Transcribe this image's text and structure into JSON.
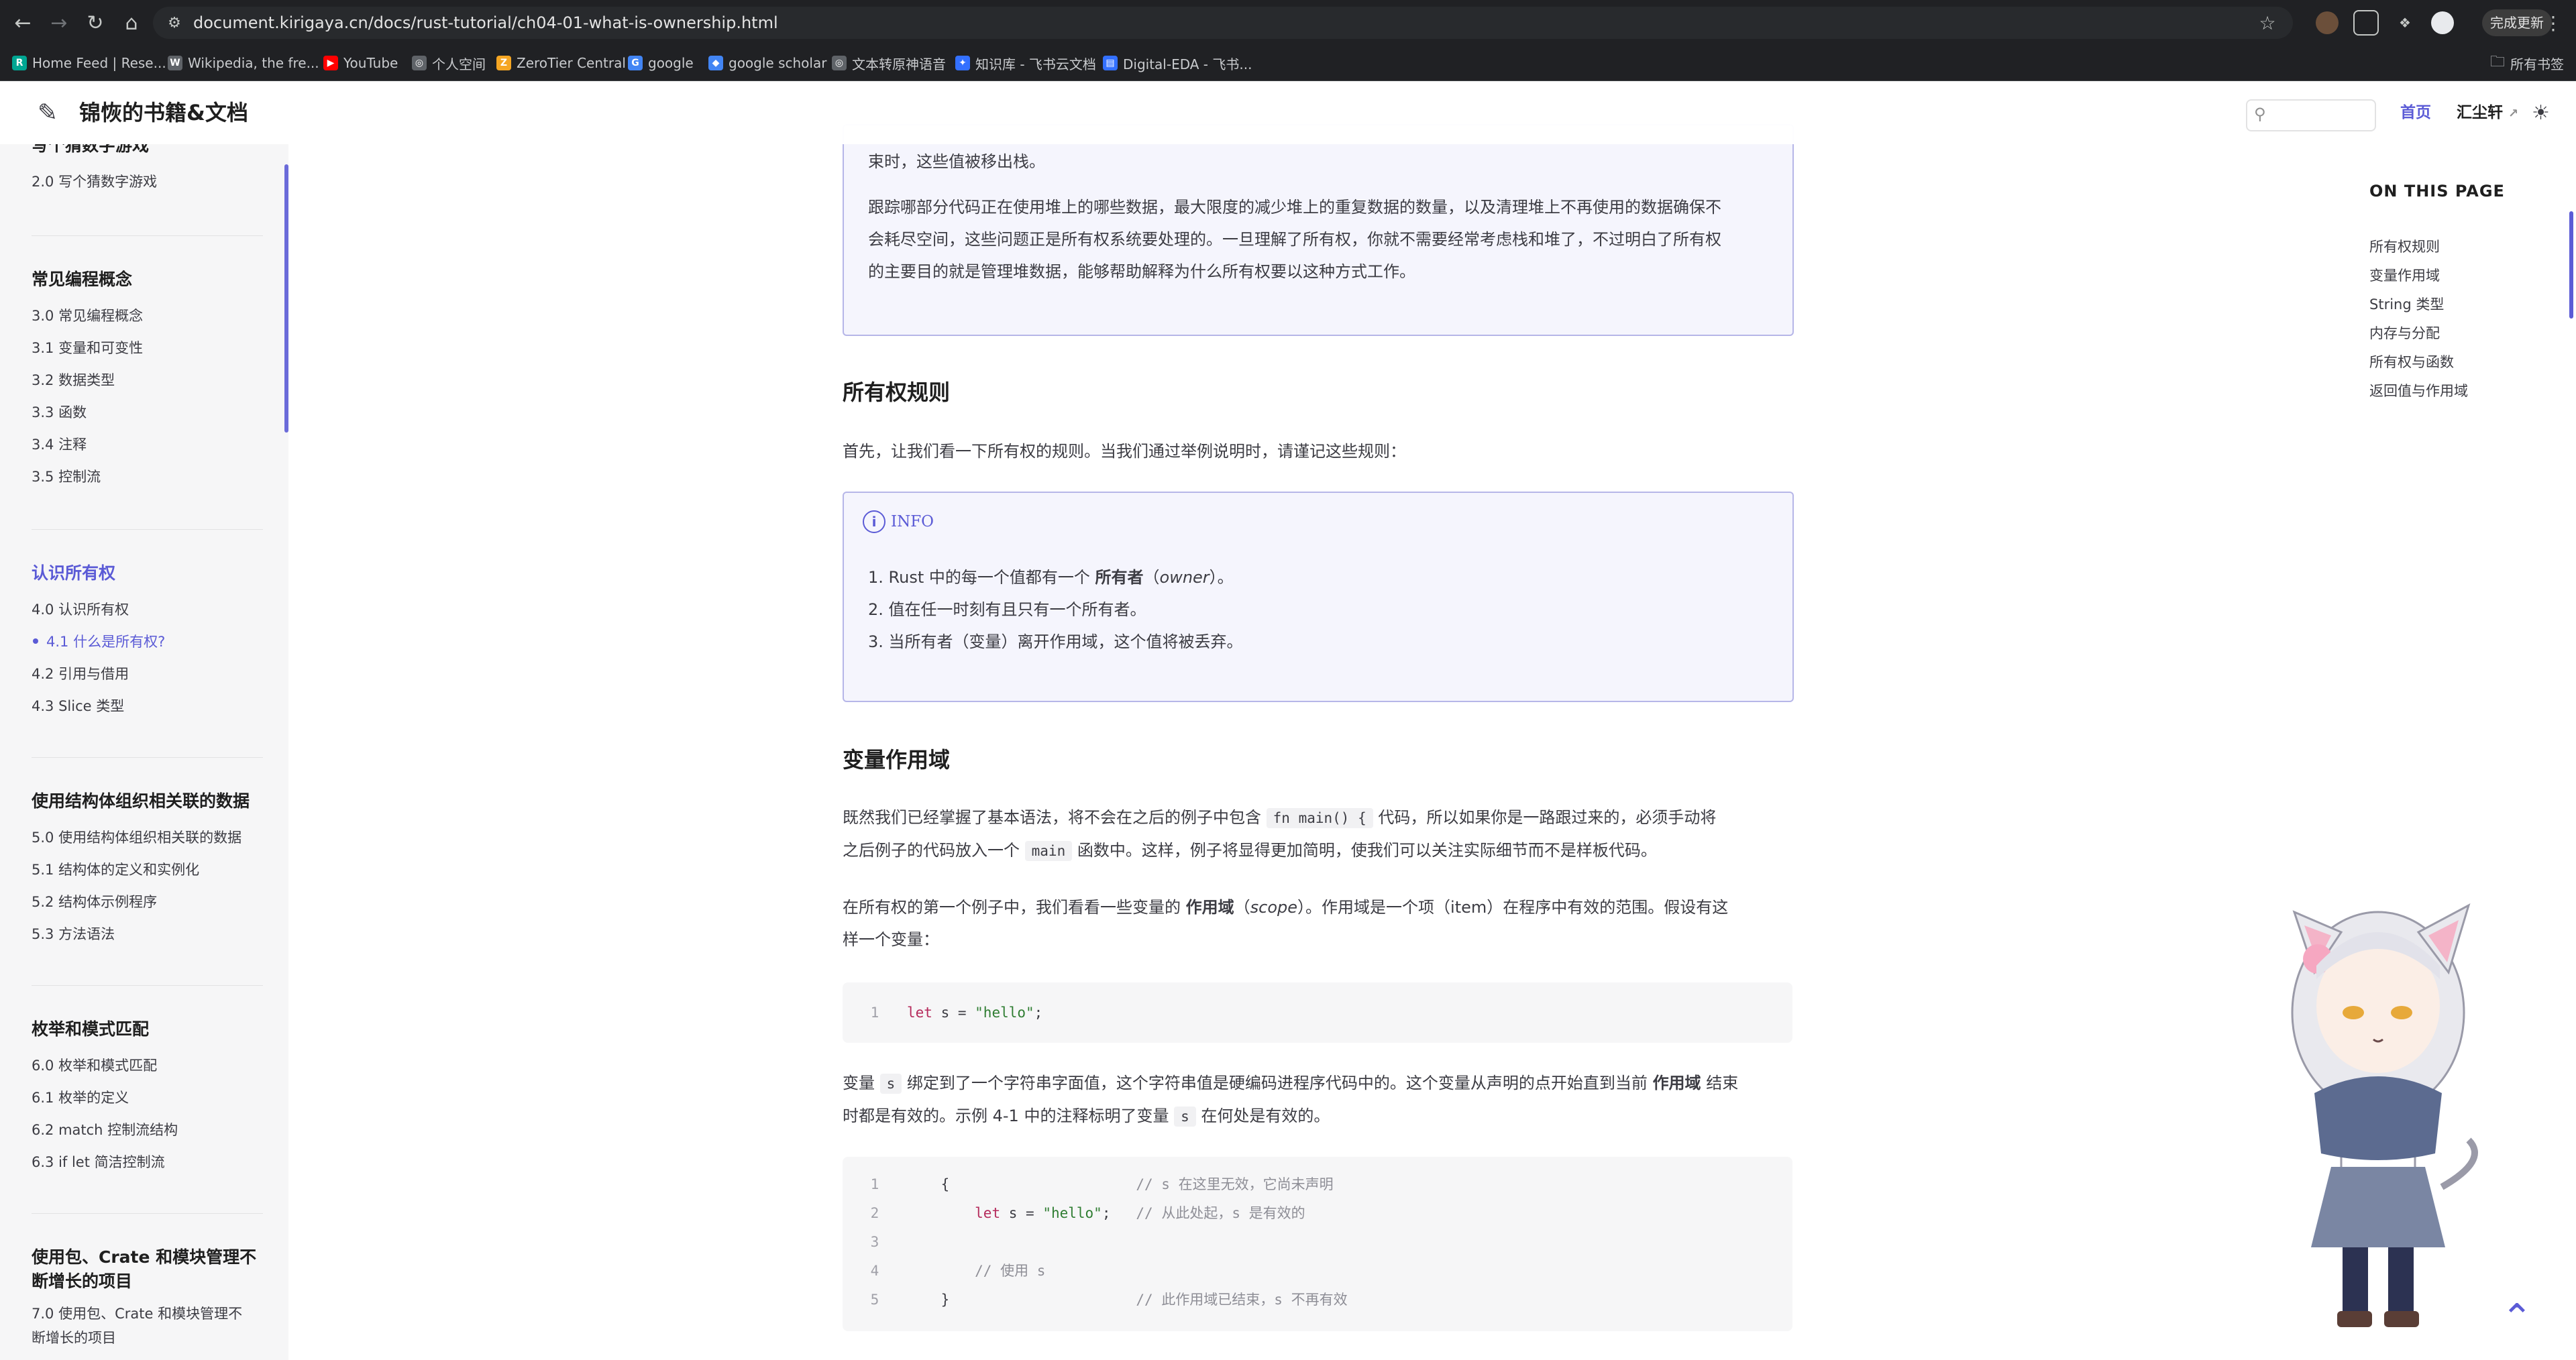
{
  "browser": {
    "url": "document.kirigaya.cn/docs/rust-tutorial/ch04-01-what-is-ownership.html",
    "update_button": "完成更新",
    "bookmarks": [
      {
        "label": "Home Feed | Rese...",
        "fav": "R",
        "color": "#00a693"
      },
      {
        "label": "Wikipedia, the fre...",
        "fav": "W",
        "color": "#5f6368"
      },
      {
        "label": "YouTube",
        "fav": "▶",
        "color": "#ff0000"
      },
      {
        "label": "个人空间",
        "fav": "◎",
        "color": "#5f6368"
      },
      {
        "label": "ZeroTier Central",
        "fav": "Z",
        "color": "#f5a623"
      },
      {
        "label": "google",
        "fav": "G",
        "color": "#4285f4"
      },
      {
        "label": "google scholar",
        "fav": "◆",
        "color": "#4285f4"
      },
      {
        "label": "文本转原神语音",
        "fav": "◎",
        "color": "#5f6368"
      },
      {
        "label": "知识库 - 飞书云文档",
        "fav": "✦",
        "color": "#3370ff"
      },
      {
        "label": "Digital-EDA - 飞书...",
        "fav": "▤",
        "color": "#3370ff"
      }
    ],
    "all_bookmarks": "所有书签"
  },
  "site": {
    "title": "锦恢的书籍&文档",
    "nav_home": "首页",
    "nav_collection": "汇尘轩"
  },
  "sidebar": {
    "groups": [
      {
        "title": "写个猜数字游戏",
        "items": [
          "2.0 写个猜数字游戏"
        ]
      },
      {
        "title": "常见编程概念",
        "items": [
          "3.0 常见编程概念",
          "3.1 变量和可变性",
          "3.2 数据类型",
          "3.3 函数",
          "3.4 注释",
          "3.5 控制流"
        ]
      },
      {
        "title": "认识所有权",
        "items": [
          "4.0 认识所有权",
          "4.1 什么是所有权?",
          "4.2 引用与借用",
          "4.3 Slice 类型"
        ]
      },
      {
        "title": "使用结构体组织相关联的数据",
        "items": [
          "5.0 使用结构体组织相关联的数据",
          "5.1 结构体的定义和实例化",
          "5.2 结构体示例程序",
          "5.3 方法语法"
        ]
      },
      {
        "title": "枚举和模式匹配",
        "items": [
          "6.0 枚举和模式匹配",
          "6.1 枚举的定义",
          "6.2 match 控制流结构",
          "6.3 if let 简洁控制流"
        ]
      },
      {
        "title_line1": "使用包、Crate 和模块管理不",
        "title_line2": "断增长的项目",
        "item_line1": "7.0 使用包、Crate 和模块管理不",
        "item_line2": "断增长的项目"
      }
    ]
  },
  "content": {
    "box1_line": "束时，这些值被移出栈。",
    "box1_para": [
      "跟踪哪部分代码正在使用堆上的哪些数据，最大限度的减少堆上的重复数据的数量，以及清理堆上不再使用的数据确保不",
      "会耗尽空间，这些问题正是所有权系统要处理的。一旦理解了所有权，你就不需要经常考虑栈和堆了，不过明白了所有权",
      "的主要目的就是管理堆数据，能够帮助解释为什么所有权要以这种方式工作。"
    ],
    "h_rules": "所有权规则",
    "rules_intro": "首先，让我们看一下所有权的规则。当我们通过举例说明时，请谨记这些规则：",
    "info_label": "INFO",
    "rule1_a": "1. Rust 中的每一个值都有一个 ",
    "rule1_b": "所有者",
    "rule1_c": "（",
    "rule1_d": "owner",
    "rule1_e": "）。",
    "rule2": "2. 值在任一时刻有且只有一个所有者。",
    "rule3": "3. 当所有者（变量）离开作用域，这个值将被丢弃。",
    "h_scope": "变量作用域",
    "p1_a": "既然我们已经掌握了基本语法，将不会在之后的例子中包含 ",
    "p1_code": "fn main() {",
    "p1_b": " 代码，所以如果你是一路跟过来的，必须手动将",
    "p1_c": "之后例子的代码放入一个 ",
    "p1_code2": "main",
    "p1_d": " 函数中。这样，例子将显得更加简明，使我们可以关注实际细节而不是样板代码。",
    "p2_a": "在所有权的第一个例子中，我们看看一些变量的 ",
    "p2_b": "作用域",
    "p2_c": "（",
    "p2_d": "scope",
    "p2_e": "）。作用域是一个项（item）在程序中有效的范围。假设有这",
    "p2_f": "样一个变量：",
    "code1": {
      "ln": "1",
      "kw": "let",
      "mid": " s = ",
      "str": "\"hello\"",
      "end": ";"
    },
    "p3_a": "变量 ",
    "p3_code": "s",
    "p3_b": " 绑定到了一个字符串字面值，这个字符串值是硬编码进程序代码中的。这个变量从声明的点开始直到当前 ",
    "p3_c": "作用域",
    "p3_d": " 结束",
    "p3_e": "时都是有效的。示例 4-1 中的注释标明了变量 ",
    "p3_code2": "s",
    "p3_f": " 在何处是有效的。",
    "code2": [
      {
        "ln": "1",
        "pre": "    {                      ",
        "cm": "// s 在这里无效，它尚未声明"
      },
      {
        "ln": "2",
        "pre": "        ",
        "kw": "let",
        "mid": " s = ",
        "str": "\"hello\"",
        "end": ";   ",
        "cm": "// 从此处起，s 是有效的"
      },
      {
        "ln": "3",
        "pre": ""
      },
      {
        "ln": "4",
        "pre": "        ",
        "cm": "// 使用 s"
      },
      {
        "ln": "5",
        "pre": "    }                      ",
        "cm": "// 此作用域已结束，s 不再有效"
      }
    ]
  },
  "toc": {
    "title": "ON THIS PAGE",
    "items": [
      "所有权规则",
      "变量作用域",
      "String 类型",
      "内存与分配",
      "所有权与函数",
      "返回值与作用域"
    ]
  },
  "colors": {
    "accent": "#5b5bd6",
    "info_bg": "#f5f5fd",
    "info_border": "#b6b6e8"
  }
}
